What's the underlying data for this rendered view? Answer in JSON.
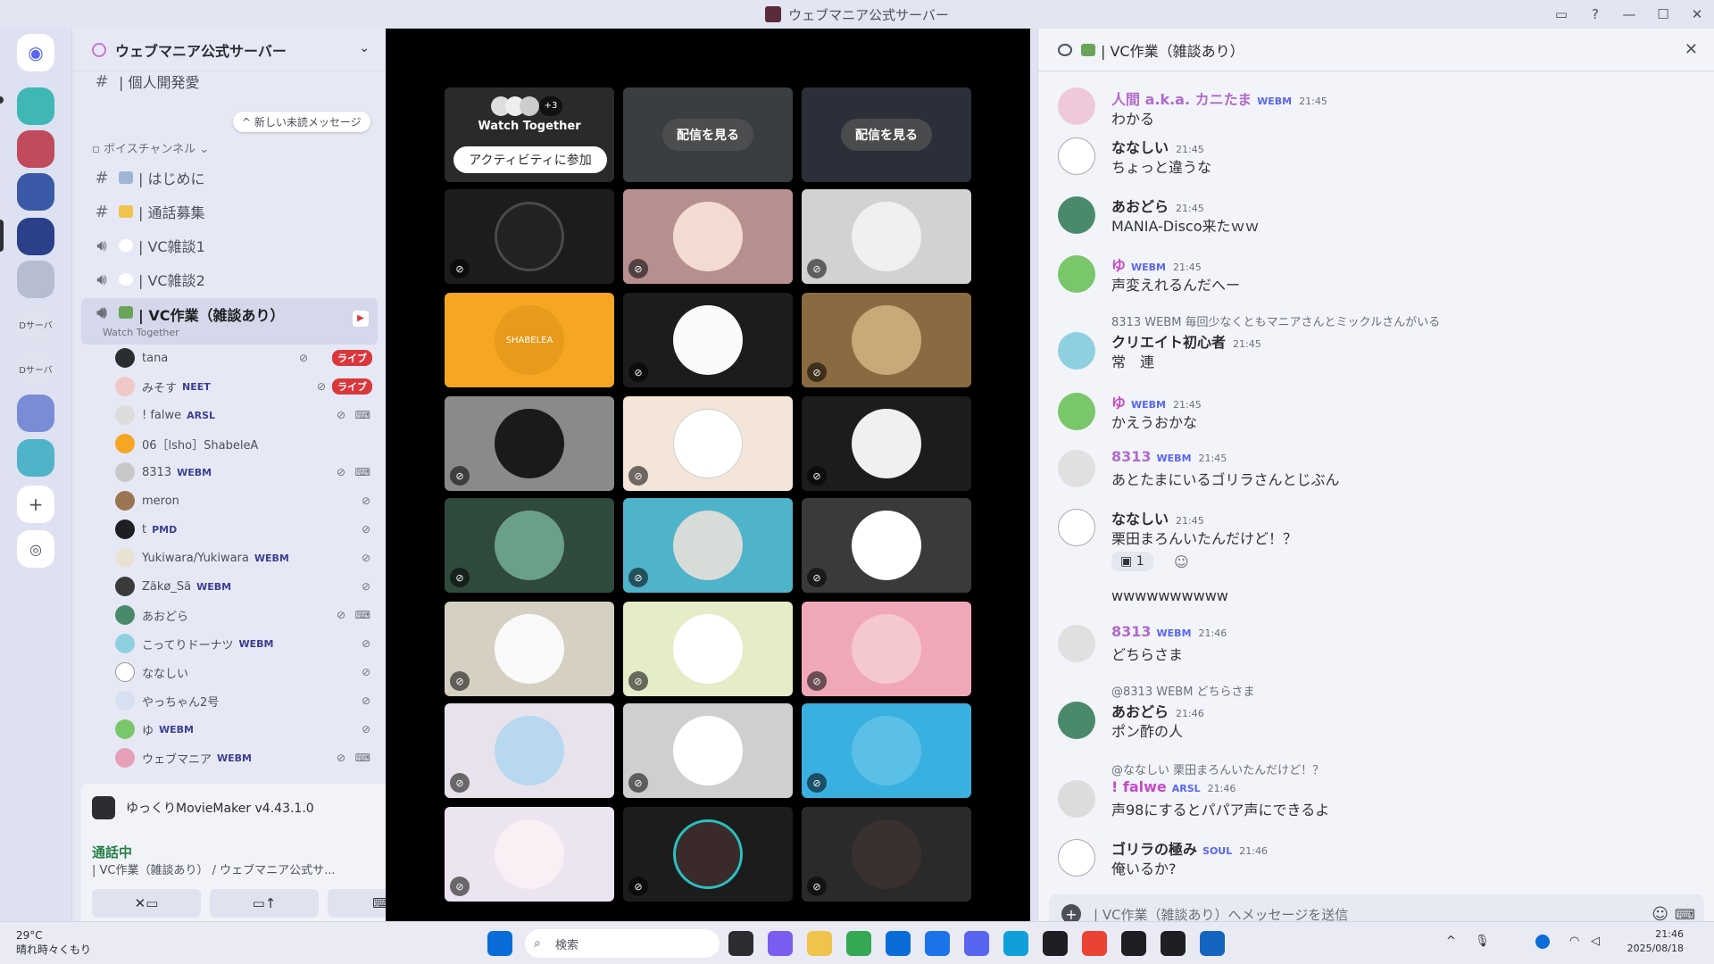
{
  "window": {
    "title": "ウェブマニア公式サーバー"
  },
  "guild": {
    "name": "ウェブマニア公式サーバー"
  },
  "sidebar": {
    "new_messages": "新しい未読メッセージ",
    "top_channel": "| 個人開発愛",
    "voice_category": "ボイスチャンネル",
    "channels": [
      {
        "label": "| はじめに"
      },
      {
        "label": "| 通話募集"
      },
      {
        "label": "| VC雑談1"
      },
      {
        "label": "| VC雑談2"
      },
      {
        "label": "| VC作業（雑談あり）",
        "sub": "Watch Together",
        "active": true
      }
    ],
    "voice_users": [
      {
        "name": "tana",
        "tag": "",
        "live": "ライブ"
      },
      {
        "name": "みそす",
        "tag": "NEET",
        "live": "ライブ"
      },
      {
        "name": "! falwe",
        "tag": "ARSL"
      },
      {
        "name": "06［lsho］ShabeleA",
        "tag": ""
      },
      {
        "name": "8313",
        "tag": "WEBM"
      },
      {
        "name": "meron",
        "tag": ""
      },
      {
        "name": "t",
        "tag": "PMD"
      },
      {
        "name": "Yukiwara/Yukiwara",
        "tag": "WEBM"
      },
      {
        "name": "Zäkø_Sä",
        "tag": "WEBM"
      },
      {
        "name": "あおどら",
        "tag": ""
      },
      {
        "name": "こってりドーナツ",
        "tag": "WEBM"
      },
      {
        "name": "ななしい",
        "tag": ""
      },
      {
        "name": "やっちゃん2号",
        "tag": ""
      },
      {
        "name": "ゆ",
        "tag": "WEBM"
      },
      {
        "name": "ウェブマニア",
        "tag": "WEBM"
      }
    ]
  },
  "activity_panel": {
    "label": "ゆっくりMovieMaker v4.43.1.0"
  },
  "voice_panel": {
    "status": "通話中",
    "where": "| VC作業（雑談あり） / ウェブマニア公式サ..."
  },
  "server_rail": {
    "label1": "Dサーバ",
    "label2": "Dサーバ"
  },
  "stage": {
    "watch_together": {
      "title": "Watch Together",
      "count": "+3",
      "join": "アクティビティに参加"
    },
    "stream_button": "配信を見る",
    "shabelea_text": "SHABELEA"
  },
  "chat": {
    "header": "| VC作業（雑談あり）",
    "composer_placeholder": "| VC作業（雑談あり）へメッセージを送信",
    "messages": [
      {
        "name": "人間 a.k.a. カニたま",
        "badge": "WEBM",
        "time": "21:45",
        "text": "わかる",
        "reply": ""
      },
      {
        "name": "ななしい",
        "badge": "",
        "time": "21:45",
        "text": "ちょっと違うな",
        "reply": ""
      },
      {
        "name": "あおどら",
        "badge": "",
        "time": "21:45",
        "text": "MANIA-Disco来たｗｗ",
        "reply": ""
      },
      {
        "name": "ゆ",
        "badge": "WEBM",
        "time": "21:45",
        "text": "声変えれるんだへー",
        "reply": ""
      },
      {
        "name": "クリエイト初心者",
        "badge": "",
        "time": "21:45",
        "text": "常　連",
        "reply": "8313 WEBM 毎回少なくともマニアさんとミックルさんがいる"
      },
      {
        "name": "ゆ",
        "badge": "WEBM",
        "time": "21:45",
        "text": "かえうおかな",
        "reply": ""
      },
      {
        "name": "8313",
        "badge": "WEBM",
        "time": "21:45",
        "text": "あとたまにいるゴリラさんとじぶん",
        "reply": ""
      },
      {
        "name": "ななしい",
        "badge": "",
        "time": "21:45",
        "text": "栗田まろんいたんだけど！？",
        "reply": "",
        "reaction": "1",
        "extra": "wwwwwwwwww"
      },
      {
        "name": "8313",
        "badge": "WEBM",
        "time": "21:46",
        "text": "どちらさま",
        "reply": ""
      },
      {
        "name": "あおどら",
        "badge": "",
        "time": "21:46",
        "text": "ポン酢の人",
        "reply": "@8313 WEBM どちらさま"
      },
      {
        "name": "! falwe",
        "badge": "ARSL",
        "time": "21:46",
        "text": "声98にするとパパア声にできるよ",
        "reply": "@ななしい 栗田まろんいたんだけど！？"
      },
      {
        "name": "ゴリラの極み",
        "badge": "SOUL",
        "time": "21:46",
        "text": "俺いるか?",
        "reply": ""
      }
    ]
  },
  "taskbar": {
    "weather_temp": "29°C",
    "weather_desc": "晴れ時々くもり",
    "search_placeholder": "検索",
    "time": "21:46",
    "date": "2025/08/18"
  },
  "colors": {
    "accent": "#5865f2",
    "live": "#da373c",
    "online": "#248046"
  }
}
